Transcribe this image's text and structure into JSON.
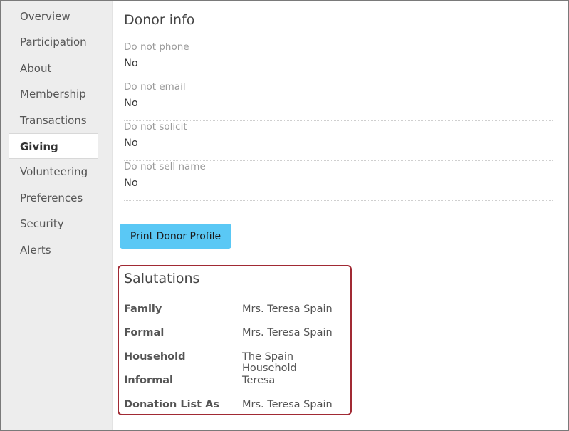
{
  "sidebar": {
    "items": [
      {
        "label": "Overview"
      },
      {
        "label": "Participation"
      },
      {
        "label": "About"
      },
      {
        "label": "Membership"
      },
      {
        "label": "Transactions"
      },
      {
        "label": "Giving",
        "active": true
      },
      {
        "label": "Volunteering"
      },
      {
        "label": "Preferences"
      },
      {
        "label": "Security"
      },
      {
        "label": "Alerts"
      }
    ]
  },
  "donor_info": {
    "title": "Donor info",
    "fields": [
      {
        "label": "Do not phone",
        "value": "No"
      },
      {
        "label": "Do not email",
        "value": "No"
      },
      {
        "label": "Do not solicit",
        "value": "No"
      },
      {
        "label": "Do not sell name",
        "value": "No"
      }
    ],
    "print_button_label": "Print Donor Profile"
  },
  "salutations": {
    "title": "Salutations",
    "rows": [
      {
        "label": "Family",
        "value": "Mrs. Teresa Spain"
      },
      {
        "label": "Formal",
        "value": "Mrs. Teresa Spain"
      },
      {
        "label": "Household",
        "value": "The Spain Household"
      },
      {
        "label": "Informal",
        "value": "Teresa"
      },
      {
        "label": "Donation List As",
        "value": "Mrs. Teresa Spain"
      }
    ]
  },
  "colors": {
    "accent_button": "#5ac8f5",
    "highlight_border": "#a12a34",
    "sidebar_bg": "#ededed"
  }
}
